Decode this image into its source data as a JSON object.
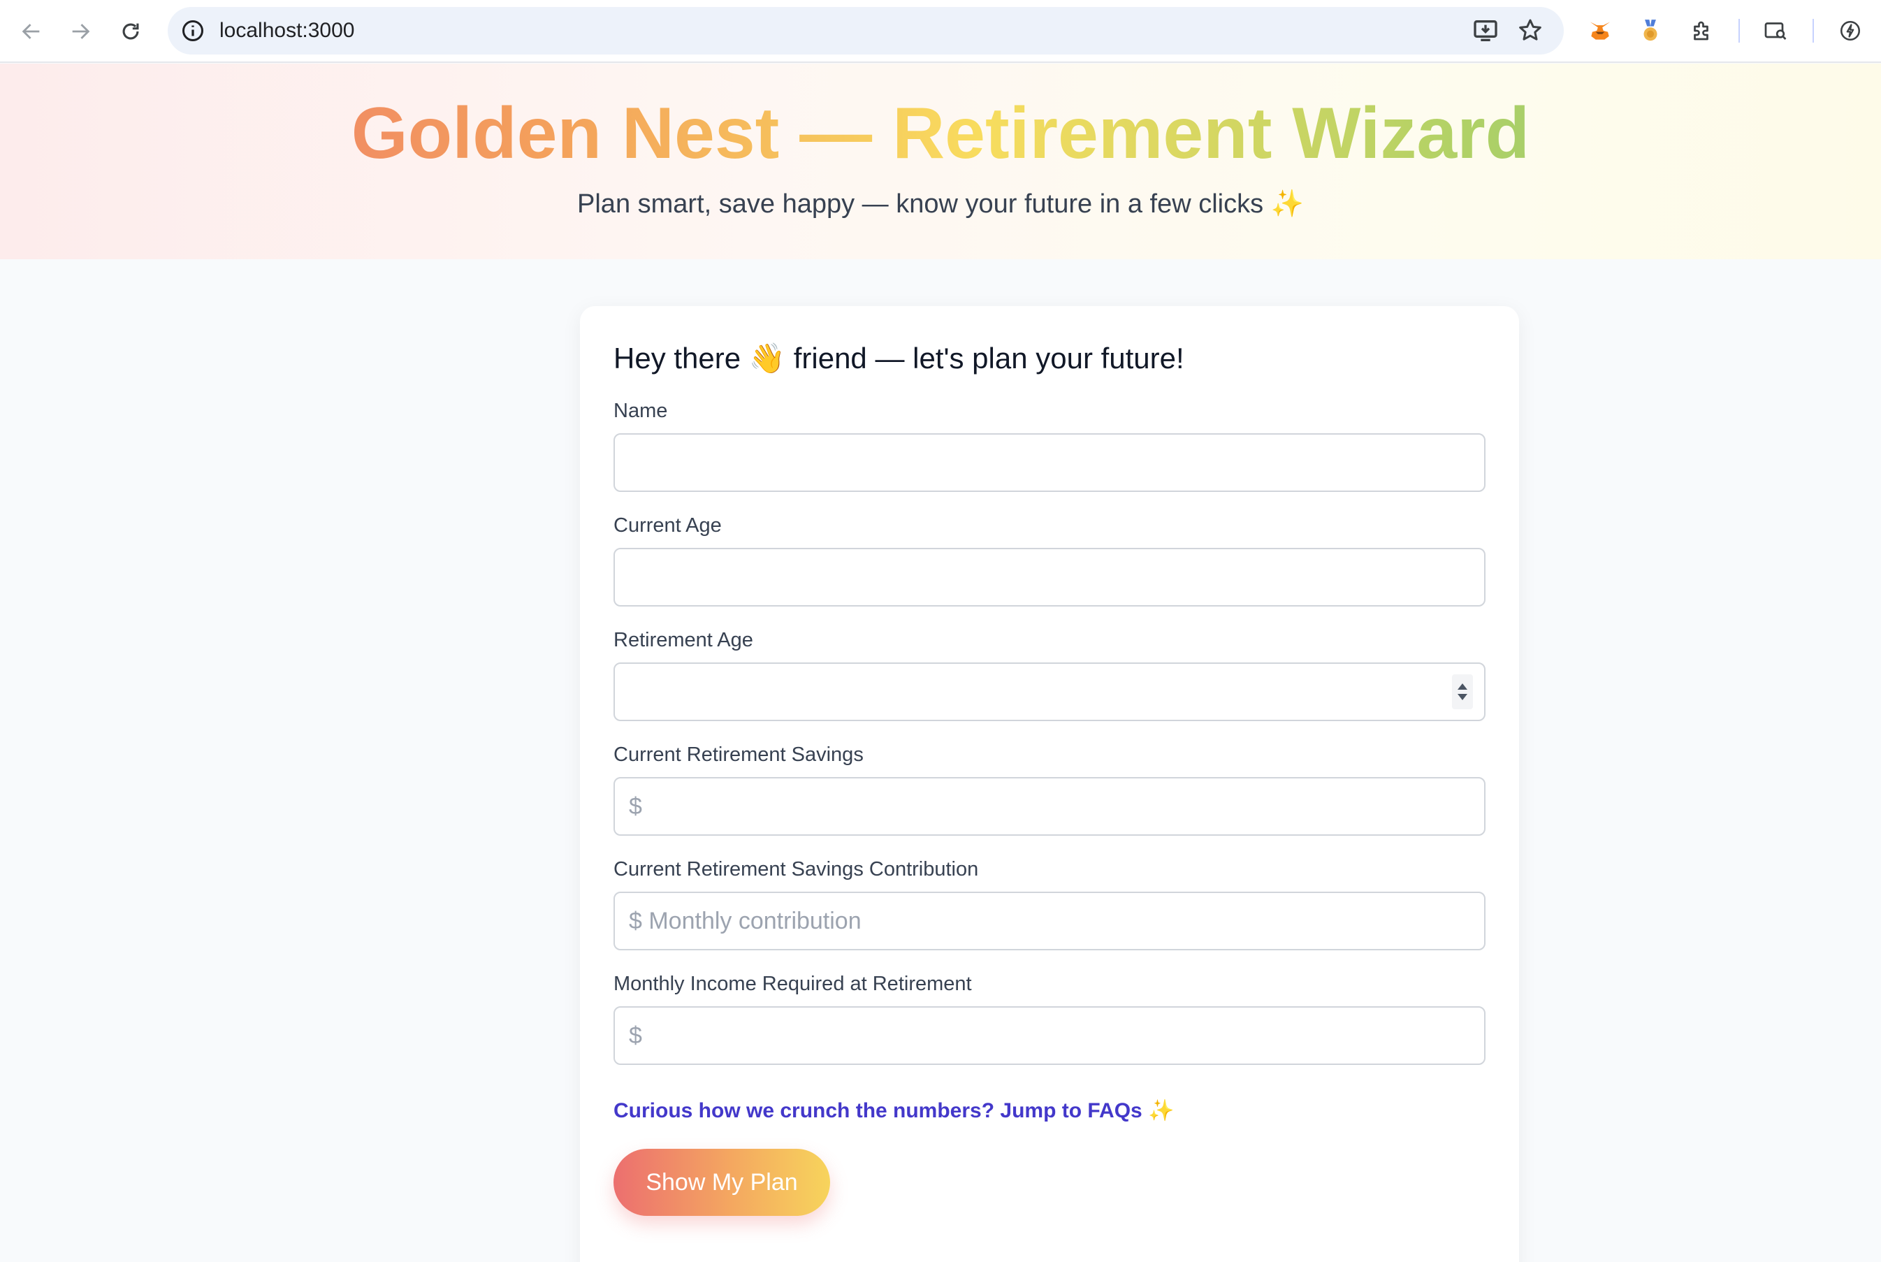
{
  "browser": {
    "url": "localhost:3000"
  },
  "hero": {
    "title": "Golden Nest — Retirement Wizard",
    "subtitle": "Plan smart, save happy — know your future in a few clicks ✨"
  },
  "form": {
    "heading": "Hey there 👋 friend — let's plan your future!",
    "fields": [
      {
        "label": "Name",
        "value": "",
        "placeholder": ""
      },
      {
        "label": "Current Age",
        "value": "",
        "placeholder": ""
      },
      {
        "label": "Retirement Age",
        "value": "",
        "placeholder": ""
      },
      {
        "label": "Current Retirement Savings",
        "value": "",
        "placeholder": "$"
      },
      {
        "label": "Current Retirement Savings Contribution",
        "value": "",
        "placeholder": "$ Monthly contribution"
      },
      {
        "label": "Monthly Income Required at Retirement",
        "value": "",
        "placeholder": "$"
      }
    ],
    "faq_link": "Curious how we crunch the numbers? Jump to FAQs ✨",
    "submit_label": "Show My Plan"
  },
  "colors": {
    "title_gradient": [
      "#ec6f6f",
      "#f4a25b",
      "#f8dc5e",
      "#b0d166",
      "#7ec27b"
    ],
    "link": "#4338ca",
    "button_gradient": [
      "#ec6f6f",
      "#f4a860",
      "#f7d45c"
    ]
  },
  "icons": [
    "back-arrow-icon",
    "forward-arrow-icon",
    "reload-icon",
    "info-icon",
    "install-app-icon",
    "bookmark-star-icon",
    "metamask-fox-icon",
    "medal-extension-icon",
    "puzzle-extensions-icon",
    "search-tabs-icon",
    "performance-icon"
  ]
}
